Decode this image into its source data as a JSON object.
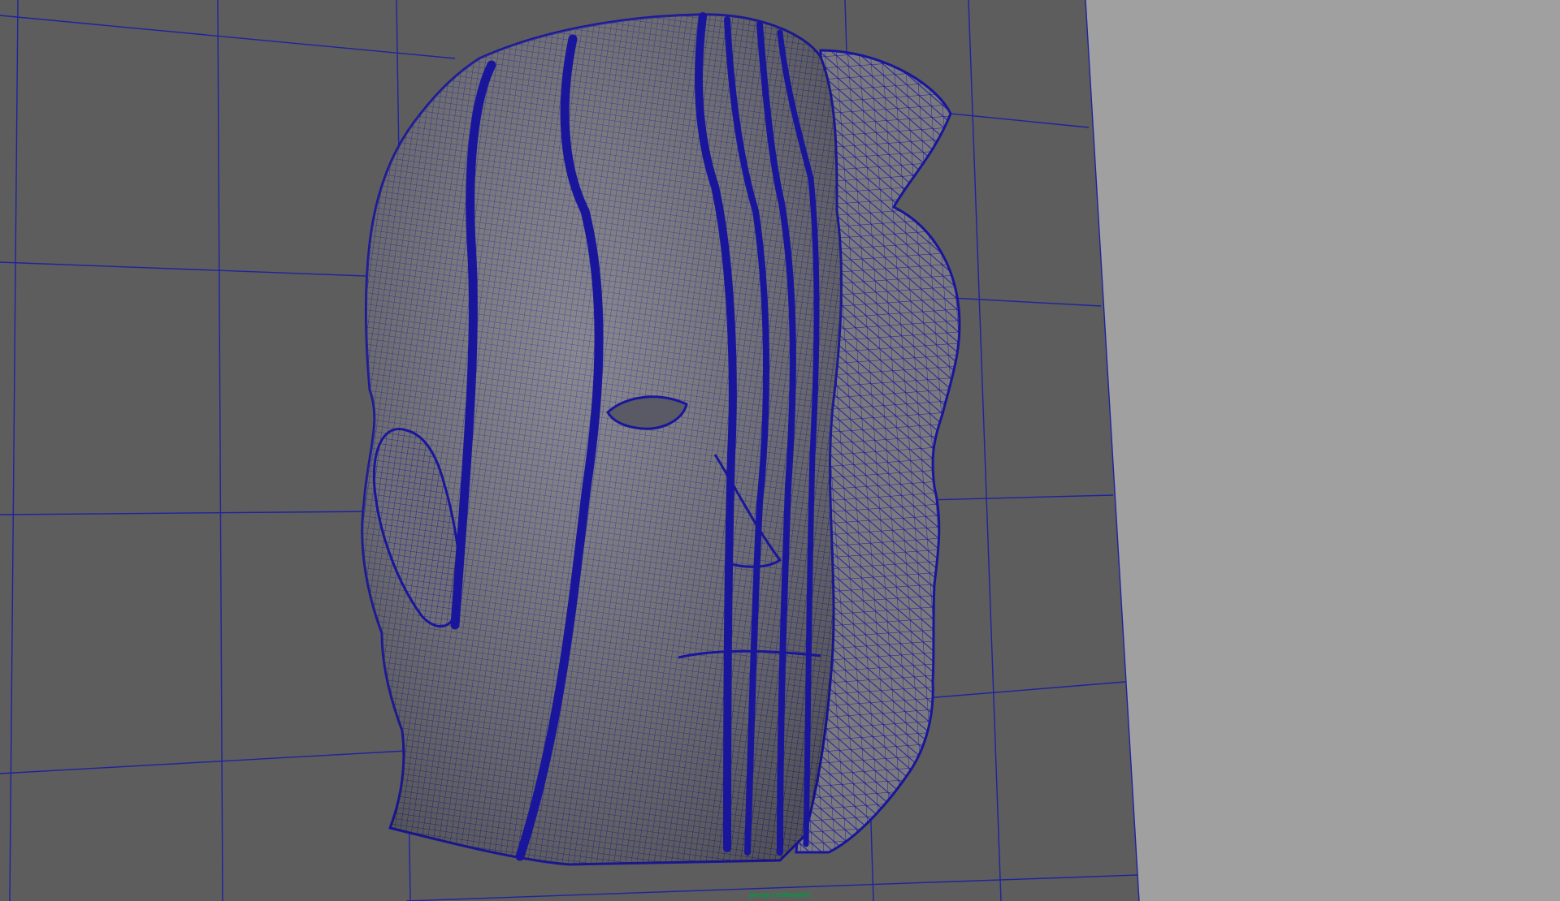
{
  "viewport": {
    "panel_name": "persp",
    "camera_label": "persp (scherper)",
    "camera_label_color": "#009a3c",
    "background_color": "#5d5d5d",
    "outer_background_color": "#a0a0a0",
    "grid_line_color": "#1f239e",
    "mesh_wire_color": "#1a169c",
    "mesh_fill_color": "#6e6e74",
    "show_grid": true,
    "display_mode": "wireframe-on-shaded"
  },
  "scene": {
    "object": "sculpted-head-sliced-mesh",
    "icon": "mesh-icon"
  }
}
